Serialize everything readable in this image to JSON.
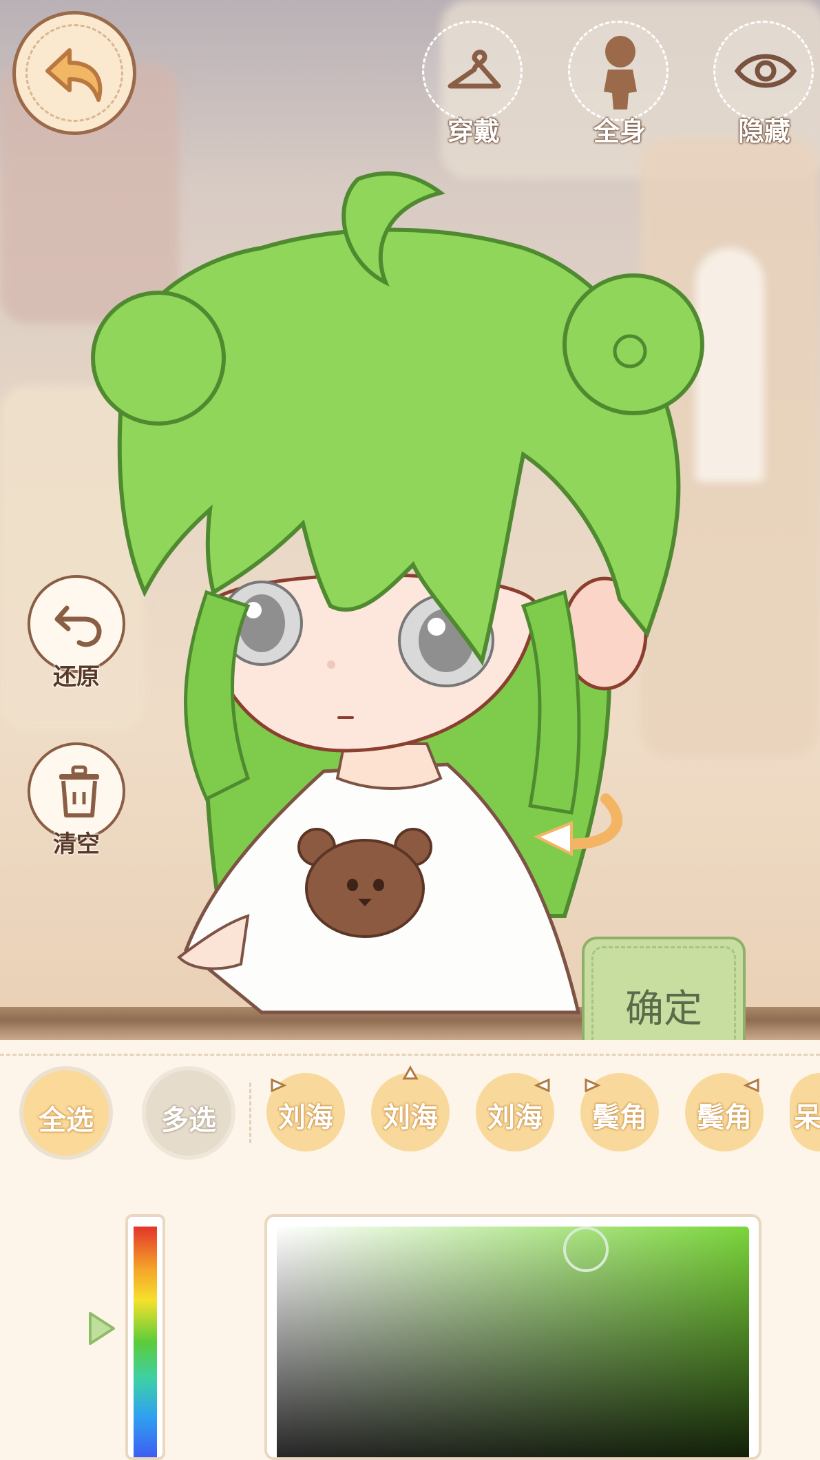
{
  "top_bar": {
    "back_icon": "back-arrow-icon",
    "buttons": [
      {
        "icon": "hanger-icon",
        "label": "穿戴"
      },
      {
        "icon": "full-body-icon",
        "label": "全身"
      },
      {
        "icon": "eye-icon",
        "label": "隐藏"
      }
    ]
  },
  "side_tools": {
    "restore": {
      "icon": "undo-icon",
      "label": "还原"
    },
    "clear": {
      "icon": "trash-icon",
      "label": "清空"
    }
  },
  "confirm_label": "确定",
  "selection": {
    "select_all": "全选",
    "multi_select": "多选",
    "parts": [
      "刘海",
      "刘海",
      "刘海",
      "鬓角",
      "鬓角",
      "呆"
    ]
  },
  "colors": {
    "hair": "#8fd65a",
    "accent_brown": "#8a5e44",
    "chip_yellow": "#f8d99b",
    "confirm_green": "#c7dea0"
  }
}
